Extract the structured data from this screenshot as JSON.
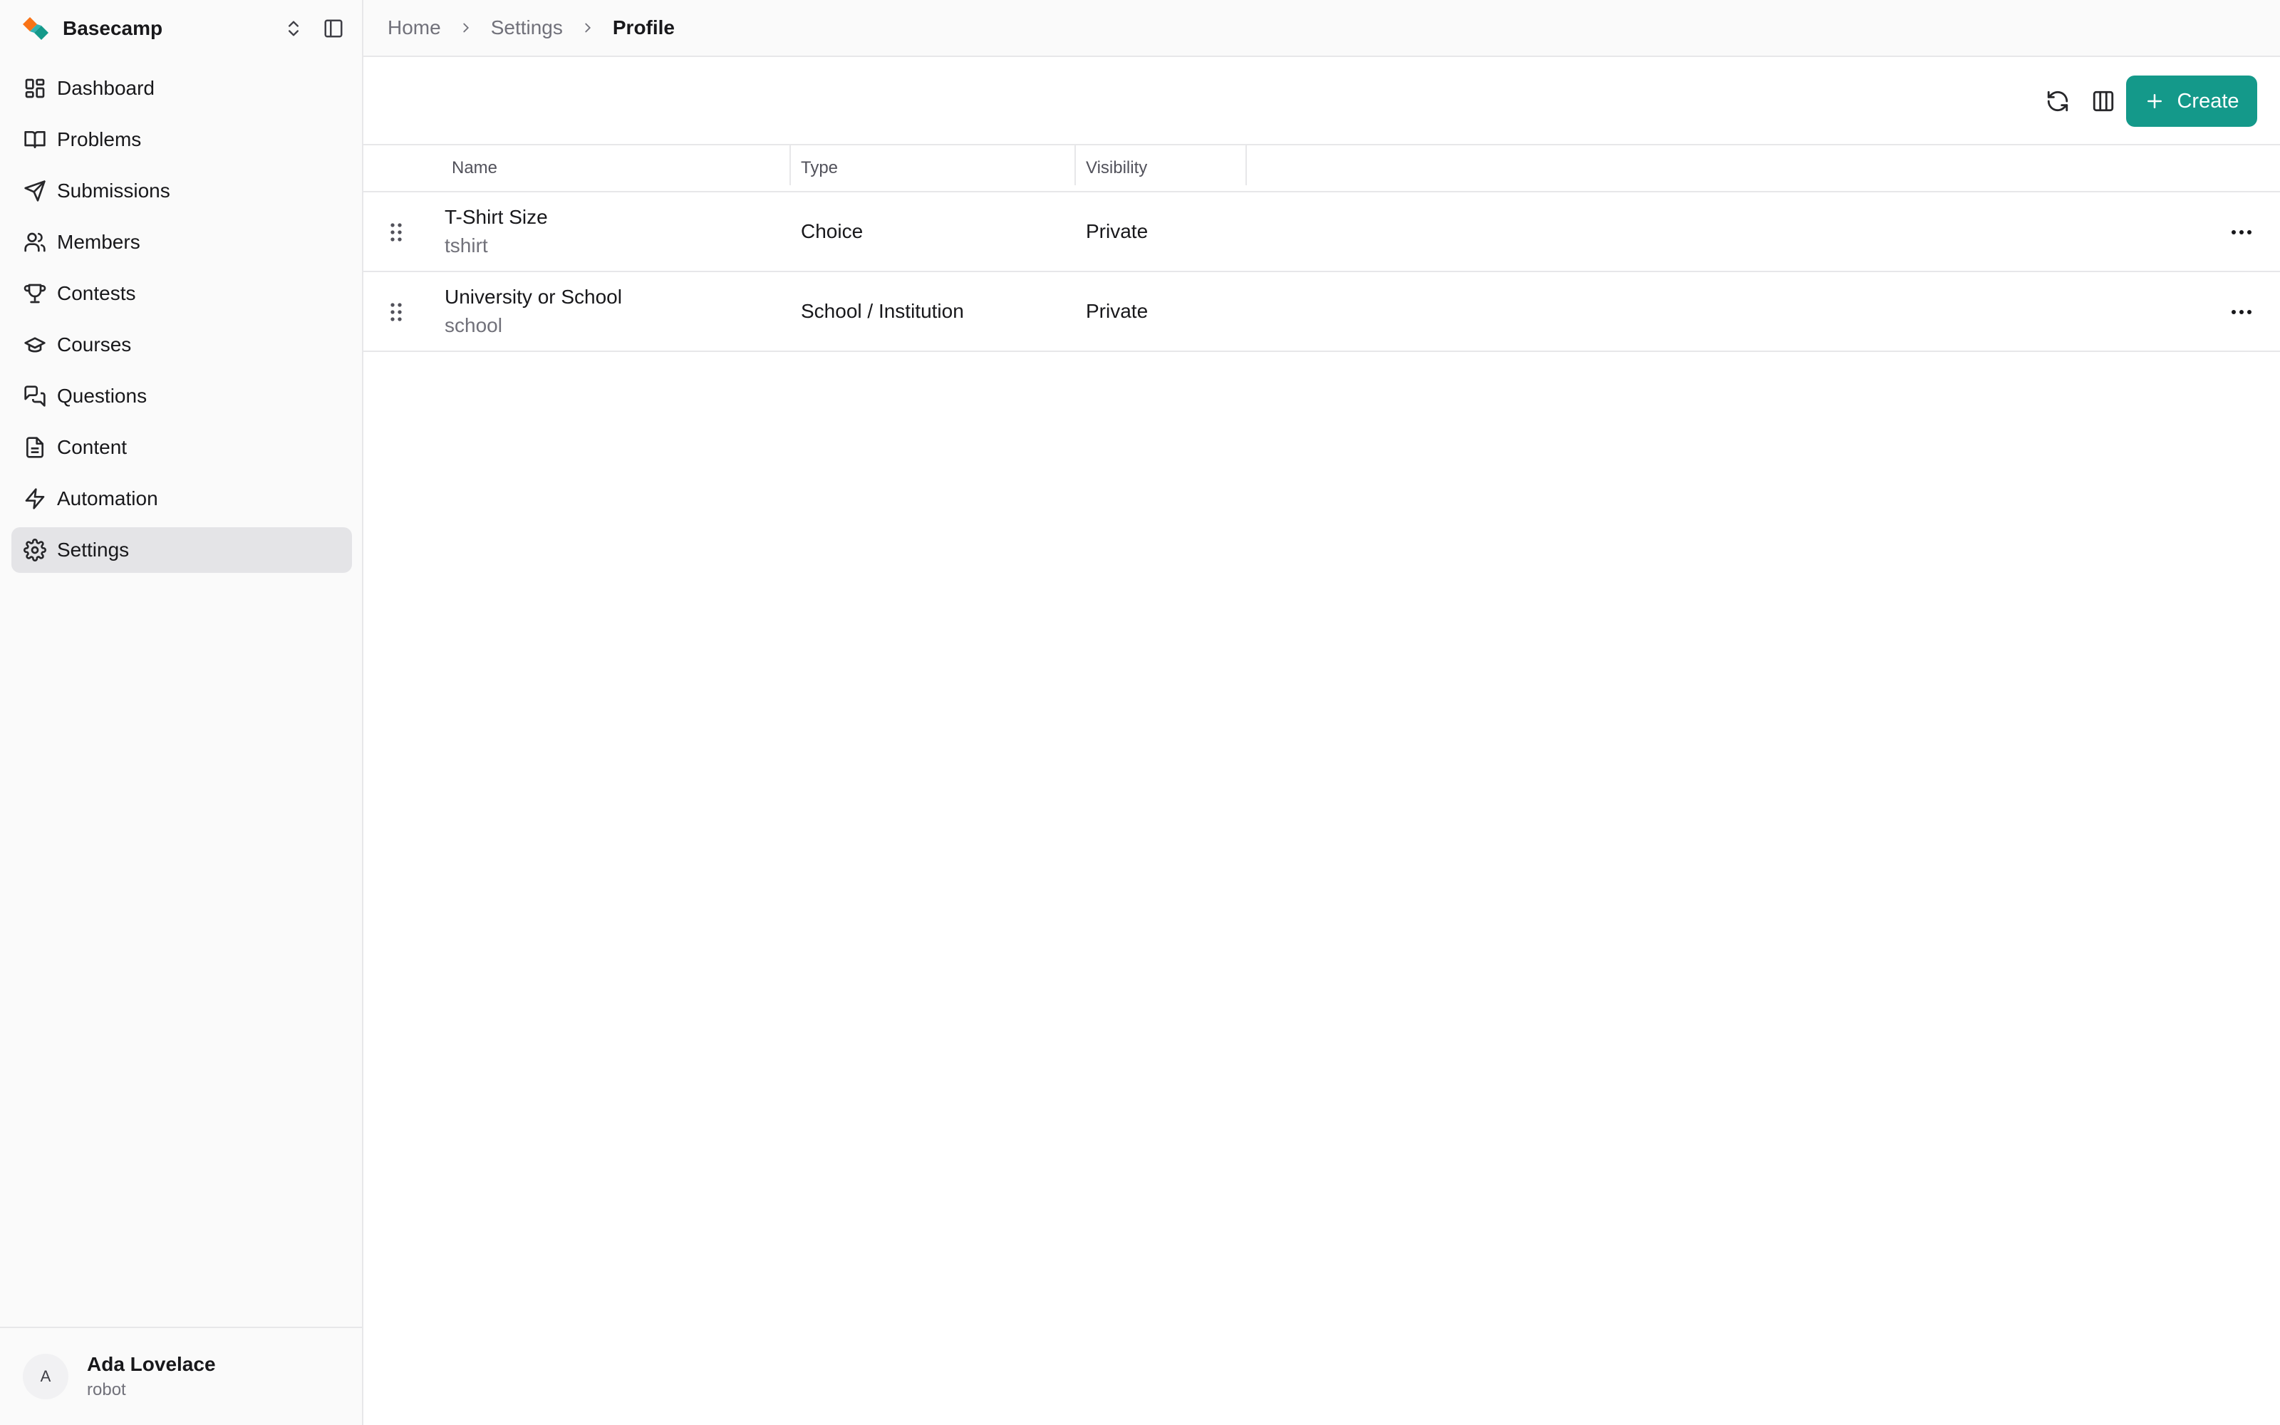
{
  "app": {
    "name": "Basecamp"
  },
  "sidebar": {
    "items": [
      {
        "label": "Dashboard",
        "icon": "dashboard-icon"
      },
      {
        "label": "Problems",
        "icon": "book-icon"
      },
      {
        "label": "Submissions",
        "icon": "send-icon"
      },
      {
        "label": "Members",
        "icon": "users-icon"
      },
      {
        "label": "Contests",
        "icon": "trophy-icon"
      },
      {
        "label": "Courses",
        "icon": "graduation-cap-icon"
      },
      {
        "label": "Questions",
        "icon": "messages-icon"
      },
      {
        "label": "Content",
        "icon": "document-icon"
      },
      {
        "label": "Automation",
        "icon": "lightning-icon"
      },
      {
        "label": "Settings",
        "icon": "gear-icon",
        "active": true
      }
    ]
  },
  "user": {
    "initial": "A",
    "name": "Ada Lovelace",
    "role": "robot"
  },
  "breadcrumb": [
    "Home",
    "Settings",
    "Profile"
  ],
  "toolbar": {
    "create_label": "Create",
    "accent": "#14998a"
  },
  "table": {
    "columns": [
      "Name",
      "Type",
      "Visibility"
    ],
    "rows": [
      {
        "name": "T-Shirt Size",
        "key": "tshirt",
        "type": "Choice",
        "visibility": "Private"
      },
      {
        "name": "University or School",
        "key": "school",
        "type": "School / Institution",
        "visibility": "Private"
      }
    ]
  }
}
